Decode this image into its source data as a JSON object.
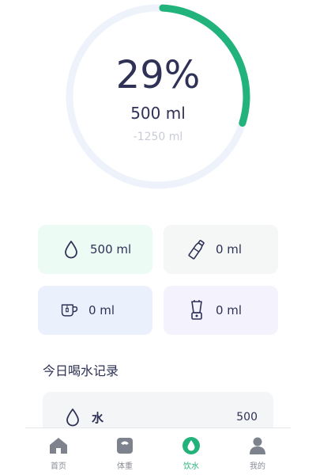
{
  "progress": {
    "fraction": 0.29,
    "percent_text": "29%",
    "amount_text": "500 ml",
    "remaining_text": "-1250 ml",
    "colors": {
      "track": "#eef3fb",
      "fill": "#22b37c"
    }
  },
  "cards": [
    {
      "icon": "water-drop-icon",
      "value": "500 ml"
    },
    {
      "icon": "bottle-icon",
      "value": "0 ml"
    },
    {
      "icon": "cup-icon",
      "value": "0 ml"
    },
    {
      "icon": "blender-icon",
      "value": "0 ml"
    }
  ],
  "records": {
    "title": "今日喝水记录",
    "items": [
      {
        "icon": "water-drop-icon",
        "name": "水",
        "value": "500"
      }
    ]
  },
  "nav": {
    "items": [
      {
        "icon": "home-icon",
        "label": "首页"
      },
      {
        "icon": "scale-icon",
        "label": "体重"
      },
      {
        "icon": "water-drop-icon",
        "label": "饮水"
      },
      {
        "icon": "user-icon",
        "label": "我的"
      }
    ],
    "active_index": 2,
    "colors": {
      "active": "#23b27a",
      "inactive": "#7d828c"
    }
  }
}
